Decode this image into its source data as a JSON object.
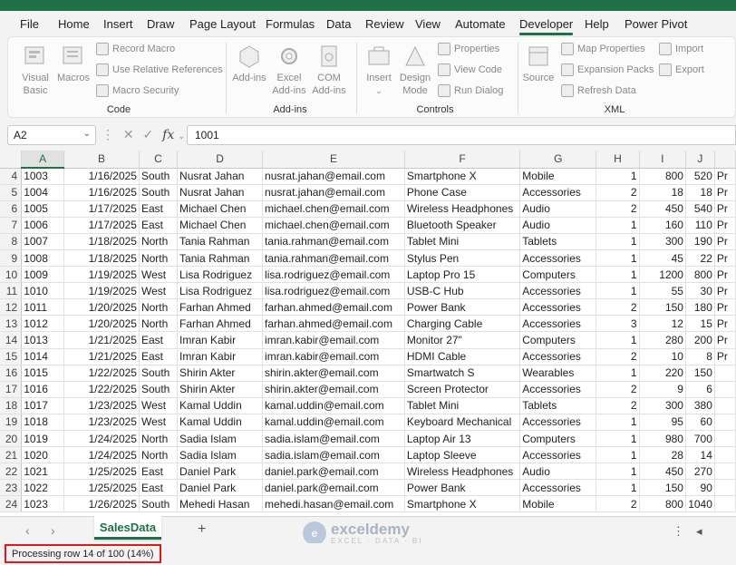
{
  "menu": [
    "File",
    "Home",
    "Insert",
    "Draw",
    "Page Layout",
    "Formulas",
    "Data",
    "Review",
    "View",
    "Automate",
    "Developer",
    "Help",
    "Power Pivot"
  ],
  "menu_active": "Developer",
  "ribbon": {
    "visual_basic": "Visual Basic",
    "macros": "Macros",
    "record_macro": "Record Macro",
    "use_relative": "Use Relative References",
    "macro_security": "Macro Security",
    "group_code": "Code",
    "addins": "Add-ins",
    "excel_addins": "Excel Add-ins",
    "com_addins": "COM Add-ins",
    "group_addins": "Add-ins",
    "insert": "Insert",
    "design_mode": "Design Mode",
    "properties": "Properties",
    "view_code": "View Code",
    "run_dialog": "Run Dialog",
    "group_controls": "Controls",
    "source": "Source",
    "map_properties": "Map Properties",
    "expansion_packs": "Expansion Packs",
    "refresh_data": "Refresh Data",
    "import": "Import",
    "export": "Export",
    "group_xml": "XML"
  },
  "formula_bar": {
    "name_box": "A2",
    "formula": "1001"
  },
  "columns": [
    "A",
    "B",
    "C",
    "D",
    "E",
    "F",
    "G",
    "H",
    "I",
    "J"
  ],
  "rows": [
    {
      "n": "4",
      "cells": [
        "1003",
        "1/16/2025",
        "South",
        "Nusrat Jahan",
        "nusrat.jahan@email.com",
        "Smartphone X",
        "Mobile",
        "1",
        "800",
        "520",
        "Pr"
      ]
    },
    {
      "n": "5",
      "cells": [
        "1004",
        "1/16/2025",
        "South",
        "Nusrat Jahan",
        "nusrat.jahan@email.com",
        "Phone Case",
        "Accessories",
        "2",
        "18",
        "18",
        "Pr"
      ]
    },
    {
      "n": "6",
      "cells": [
        "1005",
        "1/17/2025",
        "East",
        "Michael Chen",
        "michael.chen@email.com",
        "Wireless Headphones",
        "Audio",
        "2",
        "450",
        "540",
        "Pr"
      ]
    },
    {
      "n": "7",
      "cells": [
        "1006",
        "1/17/2025",
        "East",
        "Michael Chen",
        "michael.chen@email.com",
        "Bluetooth Speaker",
        "Audio",
        "1",
        "160",
        "110",
        "Pr"
      ]
    },
    {
      "n": "8",
      "cells": [
        "1007",
        "1/18/2025",
        "North",
        "Tania Rahman",
        "tania.rahman@email.com",
        "Tablet Mini",
        "Tablets",
        "1",
        "300",
        "190",
        "Pr"
      ]
    },
    {
      "n": "9",
      "cells": [
        "1008",
        "1/18/2025",
        "North",
        "Tania Rahman",
        "tania.rahman@email.com",
        "Stylus Pen",
        "Accessories",
        "1",
        "45",
        "22",
        "Pr"
      ]
    },
    {
      "n": "10",
      "cells": [
        "1009",
        "1/19/2025",
        "West",
        "Lisa Rodriguez",
        "lisa.rodriguez@email.com",
        "Laptop Pro 15",
        "Computers",
        "1",
        "1200",
        "800",
        "Pr"
      ]
    },
    {
      "n": "11",
      "cells": [
        "1010",
        "1/19/2025",
        "West",
        "Lisa Rodriguez",
        "lisa.rodriguez@email.com",
        "USB-C Hub",
        "Accessories",
        "1",
        "55",
        "30",
        "Pr"
      ]
    },
    {
      "n": "12",
      "cells": [
        "1011",
        "1/20/2025",
        "North",
        "Farhan Ahmed",
        "farhan.ahmed@email.com",
        "Power Bank",
        "Accessories",
        "2",
        "150",
        "180",
        "Pr"
      ]
    },
    {
      "n": "13",
      "cells": [
        "1012",
        "1/20/2025",
        "North",
        "Farhan Ahmed",
        "farhan.ahmed@email.com",
        "Charging Cable",
        "Accessories",
        "3",
        "12",
        "15",
        "Pr"
      ]
    },
    {
      "n": "14",
      "cells": [
        "1013",
        "1/21/2025",
        "East",
        "Imran Kabir",
        "imran.kabir@email.com",
        "Monitor 27\"",
        "Computers",
        "1",
        "280",
        "200",
        "Pr"
      ]
    },
    {
      "n": "15",
      "cells": [
        "1014",
        "1/21/2025",
        "East",
        "Imran Kabir",
        "imran.kabir@email.com",
        "HDMI Cable",
        "Accessories",
        "2",
        "10",
        "8",
        "Pr"
      ]
    },
    {
      "n": "16",
      "cells": [
        "1015",
        "1/22/2025",
        "South",
        "Shirin Akter",
        "shirin.akter@email.com",
        "Smartwatch S",
        "Wearables",
        "1",
        "220",
        "150",
        ""
      ]
    },
    {
      "n": "17",
      "cells": [
        "1016",
        "1/22/2025",
        "South",
        "Shirin Akter",
        "shirin.akter@email.com",
        "Screen Protector",
        "Accessories",
        "2",
        "9",
        "6",
        ""
      ]
    },
    {
      "n": "18",
      "cells": [
        "1017",
        "1/23/2025",
        "West",
        "Kamal Uddin",
        "kamal.uddin@email.com",
        "Tablet Mini",
        "Tablets",
        "2",
        "300",
        "380",
        ""
      ]
    },
    {
      "n": "19",
      "cells": [
        "1018",
        "1/23/2025",
        "West",
        "Kamal Uddin",
        "kamal.uddin@email.com",
        "Keyboard Mechanical",
        "Accessories",
        "1",
        "95",
        "60",
        ""
      ]
    },
    {
      "n": "20",
      "cells": [
        "1019",
        "1/24/2025",
        "North",
        "Sadia Islam",
        "sadia.islam@email.com",
        "Laptop Air 13",
        "Computers",
        "1",
        "980",
        "700",
        ""
      ]
    },
    {
      "n": "21",
      "cells": [
        "1020",
        "1/24/2025",
        "North",
        "Sadia Islam",
        "sadia.islam@email.com",
        "Laptop Sleeve",
        "Accessories",
        "1",
        "28",
        "14",
        ""
      ]
    },
    {
      "n": "22",
      "cells": [
        "1021",
        "1/25/2025",
        "East",
        "Daniel Park",
        "daniel.park@email.com",
        "Wireless Headphones",
        "Audio",
        "1",
        "450",
        "270",
        ""
      ]
    },
    {
      "n": "23",
      "cells": [
        "1022",
        "1/25/2025",
        "East",
        "Daniel Park",
        "daniel.park@email.com",
        "Power Bank",
        "Accessories",
        "1",
        "150",
        "90",
        ""
      ]
    },
    {
      "n": "24",
      "cells": [
        "1023",
        "1/26/2025",
        "South",
        "Mehedi Hasan",
        "mehedi.hasan@email.com",
        "Smartphone X",
        "Mobile",
        "2",
        "800",
        "1040",
        ""
      ]
    }
  ],
  "sheet_tab": "SalesData",
  "status": "Processing row 14 of 100 (14%)",
  "watermark": {
    "name": "exceldemy",
    "sub": "EXCEL · DATA · BI"
  }
}
